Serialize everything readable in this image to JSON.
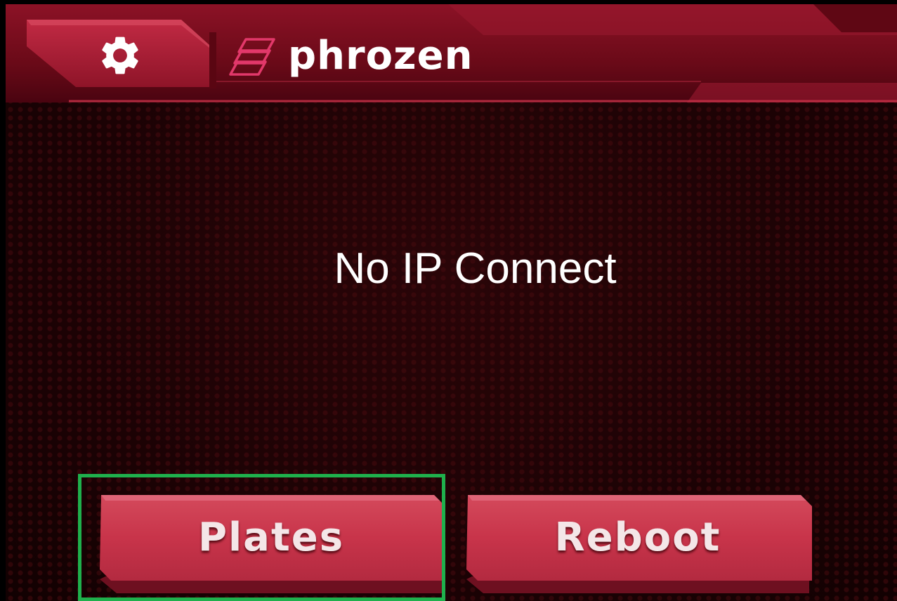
{
  "header": {
    "settings_icon": "gear-icon",
    "logo_icon": "phrozen-logo-mark",
    "brand": "phrozen"
  },
  "status": {
    "message": "No IP Connect"
  },
  "buttons": {
    "plates": "Plates",
    "reboot": "Reboot"
  },
  "colors": {
    "accent": "#c8344a",
    "header": "#7a0e1c",
    "background": "#1c0305",
    "highlight": "#1fb04c",
    "logo_mark": "#e2386a"
  }
}
